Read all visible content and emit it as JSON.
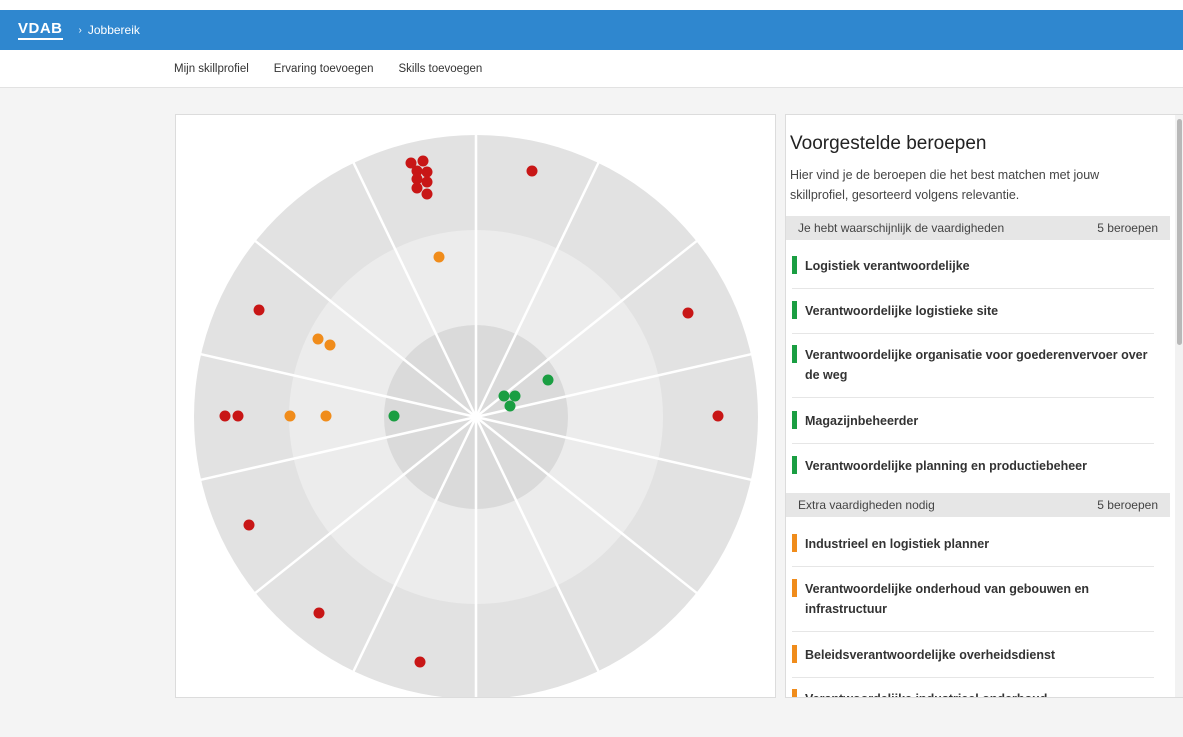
{
  "header": {
    "logo": "VDAB",
    "breadcrumb_sep": "›",
    "breadcrumb": "Jobbereik"
  },
  "nav": {
    "items": [
      "Mijn skillprofiel",
      "Ervaring toevoegen",
      "Skills toevoegen"
    ]
  },
  "radar": {
    "sectors": 14,
    "rings": [
      "inner",
      "middle",
      "outer"
    ],
    "colors": {
      "green": "#1a9e42",
      "orange": "#f08c1b",
      "red": "#c81616",
      "ring_outer": "#e2e2e2",
      "ring_middle": "#ececec",
      "ring_inner": "#dadada"
    },
    "dots": {
      "green": 5,
      "orange": 5,
      "red": 18
    }
  },
  "panel": {
    "title": "Voorgestelde beroepen",
    "description": "Hier vind je de beroepen die het best matchen met jouw skillprofiel, gesorteerd volgens relevantie.",
    "groups": [
      {
        "label": "Je hebt waarschijnlijk de vaardigheden",
        "count": "5 beroepen",
        "color": "#1a9e42",
        "jobs": [
          "Logistiek verantwoordelijke",
          "Verantwoordelijke logistieke site",
          "Verantwoordelijke organisatie voor goederenvervoer over de weg",
          "Magazijnbeheerder",
          "Verantwoordelijke planning en productiebeheer"
        ]
      },
      {
        "label": "Extra vaardigheden nodig",
        "count": "5 beroepen",
        "color": "#f08c1b",
        "jobs": [
          "Industrieel en logistiek planner",
          "Verantwoordelijke onderhoud van gebouwen en infrastructuur",
          "Beleidsverantwoordelijke overheidsdienst",
          "Verantwoordelijke industrieel onderhoud"
        ]
      }
    ]
  }
}
